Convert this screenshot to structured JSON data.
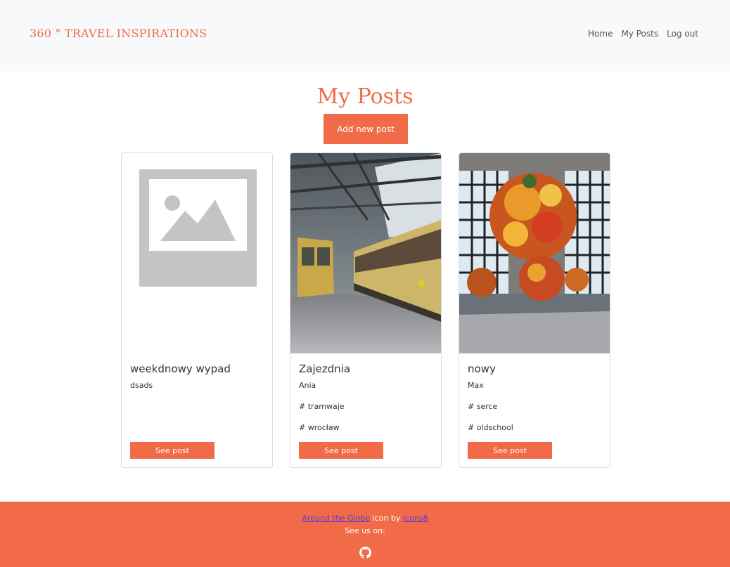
{
  "header": {
    "brand": "360 ° TRAVEL INSPIRATIONS",
    "nav": [
      {
        "label": "Home"
      },
      {
        "label": "My Posts"
      },
      {
        "label": "Log out"
      }
    ]
  },
  "main": {
    "title": "My Posts",
    "add_button": "Add new post",
    "posts": [
      {
        "title": "weekdnowy wypad",
        "author": "dsads",
        "tags": [],
        "image": "placeholder-image",
        "button": "See post"
      },
      {
        "title": "Zajezdnia",
        "author": "Ania",
        "tags": [
          "# tramwaje",
          "# wrocław"
        ],
        "image": "tram-depot-photo",
        "button": "See post"
      },
      {
        "title": "nowy",
        "author": "Max",
        "tags": [
          "# serce",
          "# oldschool"
        ],
        "image": "flower-installation-photo",
        "button": "See post"
      }
    ]
  },
  "footer": {
    "link1": "Around the Globe",
    "mid": " icon by ",
    "link2": "Icons8",
    "line2": "See us on:",
    "social_icon": "github-icon"
  },
  "colors": {
    "accent": "#f26b48",
    "nav_bg": "#f8f9fa",
    "footer_link": "#5a3bd6"
  }
}
